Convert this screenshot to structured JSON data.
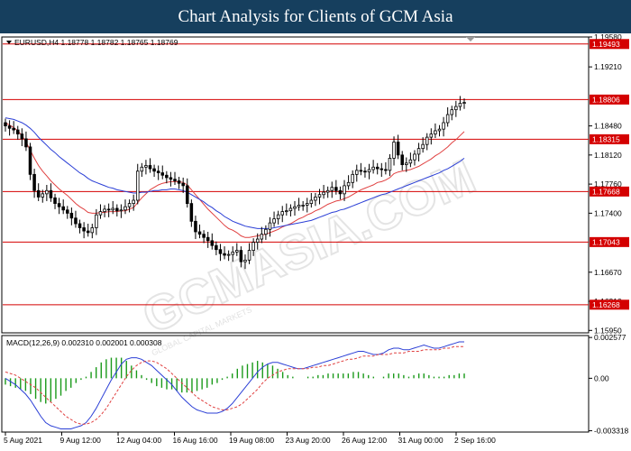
{
  "banner": {
    "title": "Chart Analysis for Clients of GCM Asia"
  },
  "watermark": {
    "main": "GCMASIA.COM",
    "sub": "GLOBAL CAPITAL MARKETS"
  },
  "chart_data": [
    {
      "type": "candlestick",
      "title": "EURUSD,H4  1.18778 1.18782 1.18765 1.18769",
      "symbol": "EURUSD,H4",
      "ohlc": {
        "open": 1.18778,
        "high": 1.18782,
        "low": 1.18765,
        "close": 1.18769
      },
      "ylim": [
        1.1592,
        1.1958
      ],
      "y_ticks": [
        "1.19580",
        "1.19210",
        "1.18480",
        "1.18120",
        "1.17760",
        "1.17400",
        "1.16670",
        "1.16310",
        "1.15950"
      ],
      "x_labels": [
        "5 Aug 2021",
        "9 Aug 12:00",
        "12 Aug 04:00",
        "16 Aug 16:00",
        "19 Aug 08:00",
        "23 Aug 20:00",
        "26 Aug 12:00",
        "31 Aug 00:00",
        "2 Sep 16:00"
      ],
      "levels": [
        {
          "value": 1.19493,
          "label": "1.19493"
        },
        {
          "value": 1.18806,
          "label": "1.18806"
        },
        {
          "value": 1.18315,
          "label": "1.18315"
        },
        {
          "value": 1.17668,
          "label": "1.17668"
        },
        {
          "value": 1.17043,
          "label": "1.17043"
        },
        {
          "value": 1.16268,
          "label": "1.16268"
        }
      ],
      "close_series": [
        1.1848,
        1.1845,
        1.1843,
        1.1838,
        1.1832,
        1.1822,
        1.1788,
        1.1768,
        1.176,
        1.1764,
        1.1768,
        1.1759,
        1.1752,
        1.1748,
        1.1744,
        1.174,
        1.1734,
        1.1727,
        1.1722,
        1.1718,
        1.1716,
        1.1722,
        1.1738,
        1.1742,
        1.1745,
        1.1744,
        1.1746,
        1.1743,
        1.1744,
        1.1748,
        1.1752,
        1.1756,
        1.1792,
        1.1797,
        1.1799,
        1.1795,
        1.1792,
        1.179,
        1.1787,
        1.1784,
        1.1782,
        1.178,
        1.1777,
        1.1774,
        1.1752,
        1.173,
        1.1717,
        1.1714,
        1.171,
        1.1706,
        1.17,
        1.1695,
        1.169,
        1.1688,
        1.1689,
        1.1692,
        1.1694,
        1.168,
        1.1682,
        1.1694,
        1.1704,
        1.1708,
        1.1714,
        1.172,
        1.1728,
        1.1733,
        1.1738,
        1.1742,
        1.1743,
        1.1746,
        1.1748,
        1.175,
        1.175,
        1.1752,
        1.1756,
        1.176,
        1.1763,
        1.1766,
        1.1768,
        1.1772,
        1.1768,
        1.1764,
        1.1774,
        1.1778,
        1.1788,
        1.1793,
        1.1792,
        1.1791,
        1.1794,
        1.1797,
        1.1795,
        1.1794,
        1.1793,
        1.1808,
        1.1828,
        1.1812,
        1.18,
        1.1802,
        1.1806,
        1.1813,
        1.182,
        1.1825,
        1.1834,
        1.1838,
        1.1842,
        1.1844,
        1.1852,
        1.1862,
        1.1868,
        1.1872,
        1.1876,
        1.1877
      ],
      "series": [
        {
          "name": "red",
          "color": "#e04040",
          "values": [
            1.1852,
            1.1849,
            1.1846,
            1.1842,
            1.1836,
            1.1828,
            1.1818,
            1.1808,
            1.1799,
            1.1792,
            1.1786,
            1.178,
            1.1775,
            1.177,
            1.1766,
            1.1762,
            1.1757,
            1.1752,
            1.1748,
            1.1745,
            1.1741,
            1.174,
            1.174,
            1.1741,
            1.1741,
            1.1742,
            1.1742,
            1.1742,
            1.1743,
            1.1743,
            1.1745,
            1.1747,
            1.1753,
            1.1759,
            1.1764,
            1.1769,
            1.1772,
            1.1775,
            1.1777,
            1.1778,
            1.1779,
            1.1779,
            1.1779,
            1.1778,
            1.1775,
            1.1769,
            1.1763,
            1.1757,
            1.1751,
            1.1745,
            1.174,
            1.1735,
            1.173,
            1.1725,
            1.1721,
            1.1719,
            1.1716,
            1.1712,
            1.171,
            1.171,
            1.1711,
            1.1712,
            1.1713,
            1.1714,
            1.1716,
            1.1718,
            1.172,
            1.1723,
            1.1725,
            1.1727,
            1.173,
            1.1733,
            1.1735,
            1.1738,
            1.174,
            1.1743,
            1.1745,
            1.1748,
            1.1751,
            1.1753,
            1.1755,
            1.1756,
            1.1758,
            1.176,
            1.1763,
            1.1766,
            1.1769,
            1.1771,
            1.1773,
            1.1775,
            1.1778,
            1.1779,
            1.1781,
            1.1784,
            1.1789,
            1.1791,
            1.1792,
            1.1793,
            1.1794,
            1.1796,
            1.1798,
            1.1801,
            1.1804,
            1.1807,
            1.1811,
            1.1814,
            1.1818,
            1.1822,
            1.1827,
            1.1831,
            1.1836,
            1.1841
          ]
        },
        {
          "name": "blue",
          "color": "#2b3fd6",
          "values": [
            1.1858,
            1.1857,
            1.1856,
            1.1854,
            1.1852,
            1.1849,
            1.1845,
            1.184,
            1.1834,
            1.1829,
            1.1824,
            1.1819,
            1.1815,
            1.181,
            1.1806,
            1.1802,
            1.1798,
            1.1794,
            1.179,
            1.1787,
            1.1783,
            1.178,
            1.1778,
            1.1776,
            1.1774,
            1.1772,
            1.1771,
            1.1769,
            1.1768,
            1.1767,
            1.1766,
            1.1765,
            1.1765,
            1.1766,
            1.1766,
            1.1767,
            1.1768,
            1.1768,
            1.1769,
            1.1769,
            1.177,
            1.177,
            1.1769,
            1.1768,
            1.1766,
            1.1763,
            1.176,
            1.1757,
            1.1754,
            1.175,
            1.1747,
            1.1743,
            1.174,
            1.1736,
            1.1733,
            1.173,
            1.1728,
            1.1726,
            1.1724,
            1.1723,
            1.1722,
            1.1721,
            1.1721,
            1.1721,
            1.1721,
            1.1722,
            1.1723,
            1.1724,
            1.1725,
            1.1726,
            1.1727,
            1.1728,
            1.1729,
            1.173,
            1.1731,
            1.1733,
            1.1735,
            1.1737,
            1.1739,
            1.1741,
            1.1742,
            1.1744,
            1.1745,
            1.1747,
            1.1749,
            1.1751,
            1.1753,
            1.1755,
            1.1757,
            1.1759,
            1.1761,
            1.1763,
            1.1764,
            1.1766,
            1.1768,
            1.177,
            1.1772,
            1.1774,
            1.1776,
            1.1778,
            1.178,
            1.1782,
            1.1784,
            1.1786,
            1.1788,
            1.179,
            1.1793,
            1.1795,
            1.1798,
            1.1801,
            1.1804,
            1.1808
          ]
        }
      ]
    },
    {
      "type": "macd",
      "title": "MACD(12,26,9) 0.002310 0.002001 0.000308",
      "params": "MACD(12,26,9)",
      "values_readout": {
        "macd": 0.00231,
        "signal": 0.002001,
        "histogram": 0.000308
      },
      "ylim": [
        -0.0034,
        0.0027
      ],
      "y_ticks": [
        "0.002577",
        "0.00",
        "-0.003318"
      ],
      "macd_line": [
        0.0,
        -0.0002,
        -0.0004,
        -0.0007,
        -0.001,
        -0.0014,
        -0.0019,
        -0.0024,
        -0.0028,
        -0.003,
        -0.0031,
        -0.0032,
        -0.0032,
        -0.0032,
        -0.0031,
        -0.003,
        -0.0028,
        -0.0024,
        -0.0019,
        -0.0013,
        -0.0007,
        -0.0001,
        0.0004,
        0.0009,
        0.0012,
        0.0013,
        0.0013,
        0.0012,
        0.001,
        0.0008,
        0.0005,
        0.0002,
        -0.0001,
        -0.0004,
        -0.0008,
        -0.0012,
        -0.0015,
        -0.0018,
        -0.002,
        -0.0021,
        -0.0022,
        -0.0022,
        -0.0022,
        -0.0021,
        -0.0019,
        -0.0016,
        -0.0012,
        -0.0008,
        -0.0004,
        0.0,
        0.0004,
        0.0007,
        0.0009,
        0.001,
        0.001,
        0.0009,
        0.0008,
        0.0007,
        0.0006,
        0.0006,
        0.0007,
        0.0008,
        0.0009,
        0.001,
        0.0011,
        0.0012,
        0.0013,
        0.0014,
        0.0015,
        0.0016,
        0.0017,
        0.0017,
        0.0016,
        0.0015,
        0.0015,
        0.0016,
        0.0018,
        0.0019,
        0.0019,
        0.0018,
        0.0018,
        0.0019,
        0.002,
        0.0021,
        0.002,
        0.0019,
        0.0019,
        0.002,
        0.0021,
        0.0022,
        0.0023,
        0.0023
      ],
      "signal_line": [
        0.0004,
        0.0003,
        0.0002,
        0.0,
        -0.0002,
        -0.0004,
        -0.0006,
        -0.0009,
        -0.0012,
        -0.0015,
        -0.0018,
        -0.0021,
        -0.0024,
        -0.0026,
        -0.0028,
        -0.0029,
        -0.0029,
        -0.0028,
        -0.0026,
        -0.0023,
        -0.0019,
        -0.0014,
        -0.0009,
        -0.0004,
        0.0001,
        0.0005,
        0.0008,
        0.001,
        0.0011,
        0.0011,
        0.001,
        0.0008,
        0.0006,
        0.0003,
        0.0,
        -0.0003,
        -0.0006,
        -0.0009,
        -0.0012,
        -0.0014,
        -0.0016,
        -0.0018,
        -0.0019,
        -0.002,
        -0.002,
        -0.0019,
        -0.0018,
        -0.0016,
        -0.0013,
        -0.001,
        -0.0007,
        -0.0003,
        0.0,
        0.0002,
        0.0004,
        0.0005,
        0.0006,
        0.0006,
        0.0006,
        0.0006,
        0.0006,
        0.0007,
        0.0007,
        0.0008,
        0.0008,
        0.0009,
        0.001,
        0.0011,
        0.0012,
        0.0012,
        0.0013,
        0.0014,
        0.0014,
        0.0014,
        0.0015,
        0.0015,
        0.0015,
        0.0016,
        0.0016,
        0.0016,
        0.0017,
        0.0017,
        0.0017,
        0.0018,
        0.0018,
        0.0018,
        0.0018,
        0.0019,
        0.0019,
        0.002,
        0.002,
        0.002
      ]
    }
  ],
  "colors": {
    "candle_up": "#ffffff",
    "candle_down": "#000000",
    "level": "#d40000",
    "macd_hist": "#1a9a1a",
    "banner_bg": "#163f5e"
  }
}
